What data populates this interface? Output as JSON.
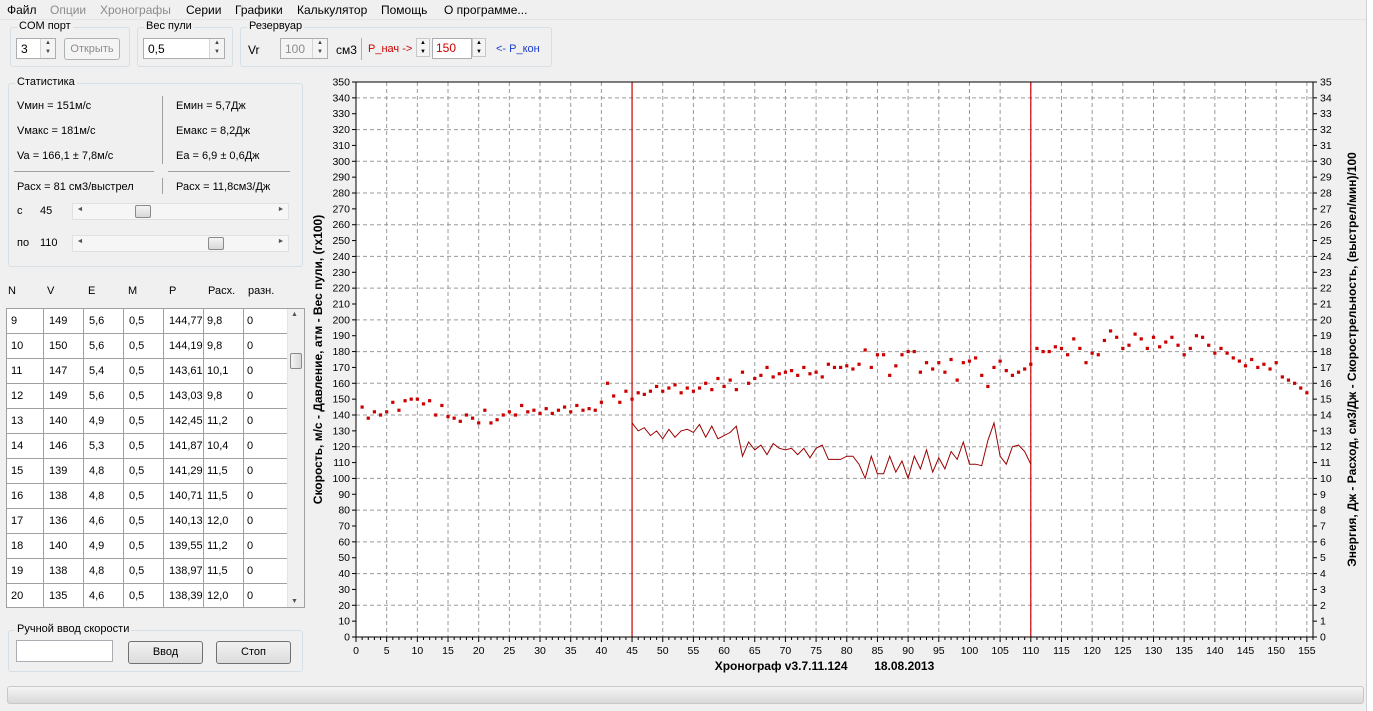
{
  "menu": [
    "Файл",
    "Опции",
    "Хронографы",
    "Серии",
    "Графики",
    "Калькулятор",
    "Помощь",
    "О программе..."
  ],
  "menu_disabled": [
    false,
    true,
    true,
    false,
    false,
    false,
    false,
    false
  ],
  "com": {
    "title": "COM порт",
    "value": "3",
    "open_label": "Открыть"
  },
  "bullet": {
    "title": "Вес пули",
    "value": "0,5"
  },
  "reservoir": {
    "title": "Резервуар",
    "vr_label": "Vr",
    "vr_value": "100",
    "unit": "см3",
    "p_start_label": "P_нач ->",
    "p_value": "150",
    "p_end_label": "<- P_кон"
  },
  "stats": {
    "title": "Статистика",
    "vmin": "Vмин = 151м/с",
    "vmax": "Vмакс = 181м/с",
    "va": "Va = 166,1 ± 7,8м/с",
    "emin": "Eмин = 5,7Дж",
    "emax": "Eмакс = 8,2Дж",
    "ea": "Ea = 6,9 ± 0,6Дж",
    "rate_shot": "Расх = 81 см3/выстрел",
    "rate_j": "Расх = 11,8см3/Дж",
    "from_label": "с",
    "from_value": "45",
    "from_fraction": 0.29,
    "to_label": "по",
    "to_value": "110",
    "to_fraction": 0.71
  },
  "table": {
    "headers": [
      "N",
      "V",
      "E",
      "M",
      "P",
      "Расх.",
      "разн."
    ],
    "rows": [
      [
        "9",
        "149",
        "5,6",
        "0,5",
        "144,77",
        "9,8",
        "0"
      ],
      [
        "10",
        "150",
        "5,6",
        "0,5",
        "144,19",
        "9,8",
        "0"
      ],
      [
        "11",
        "147",
        "5,4",
        "0,5",
        "143,61",
        "10,1",
        "0"
      ],
      [
        "12",
        "149",
        "5,6",
        "0,5",
        "143,03",
        "9,8",
        "0"
      ],
      [
        "13",
        "140",
        "4,9",
        "0,5",
        "142,45",
        "11,2",
        "0"
      ],
      [
        "14",
        "146",
        "5,3",
        "0,5",
        "141,87",
        "10,4",
        "0"
      ],
      [
        "15",
        "139",
        "4,8",
        "0,5",
        "141,29",
        "11,5",
        "0"
      ],
      [
        "16",
        "138",
        "4,8",
        "0,5",
        "140,71",
        "11,5",
        "0"
      ],
      [
        "17",
        "136",
        "4,6",
        "0,5",
        "140,13",
        "12,0",
        "0"
      ],
      [
        "18",
        "140",
        "4,9",
        "0,5",
        "139,55",
        "11,2",
        "0"
      ],
      [
        "19",
        "138",
        "4,8",
        "0,5",
        "138,97",
        "11,5",
        "0"
      ],
      [
        "20",
        "135",
        "4,6",
        "0,5",
        "138,39",
        "12,0",
        "0"
      ]
    ],
    "scroll_fraction": 0.12
  },
  "manual": {
    "title": "Ручной ввод скорости",
    "input_value": "",
    "enter_label": "Ввод",
    "stop_label": "Стоп"
  },
  "chart_data": {
    "type": "scatter",
    "xlabel": "Хронограф v3.7.11.124        18.08.2013",
    "ylabel_left": "Скорость, м/с - Давление, атм - Вес пули, (гх100)",
    "ylabel_right": "Энергия, Дж - Расход, см3/Дж - Скорострельность, (выстрел/мин)/100",
    "xlim": [
      0,
      156
    ],
    "ylim_left": [
      0,
      350
    ],
    "ylim_right": [
      0,
      35
    ],
    "x_ticks": [
      0,
      5,
      10,
      15,
      20,
      25,
      30,
      35,
      40,
      45,
      50,
      55,
      60,
      65,
      70,
      75,
      80,
      85,
      90,
      95,
      100,
      105,
      110,
      115,
      120,
      125,
      130,
      135,
      140,
      145,
      150,
      155
    ],
    "y_left_step": 10,
    "y_right_step": 1,
    "grid": true,
    "vertical_markers": [
      45,
      110
    ],
    "colors": {
      "points": "#cc0000",
      "line": "#990000",
      "markers": "#cc0000",
      "grid": "#9a9a9a"
    },
    "series": [
      {
        "type": "scatter",
        "axis": "left",
        "x": [
          1,
          2,
          3,
          4,
          5,
          6,
          7,
          8,
          9,
          10,
          11,
          12,
          13,
          14,
          15,
          16,
          17,
          18,
          19,
          20,
          21,
          22,
          23,
          24,
          25,
          26,
          27,
          28,
          29,
          30,
          31,
          32,
          33,
          34,
          35,
          36,
          37,
          38,
          39,
          40,
          41,
          42,
          43,
          44,
          45,
          46,
          47,
          48,
          49,
          50,
          51,
          52,
          53,
          54,
          55,
          56,
          57,
          58,
          59,
          60,
          61,
          62,
          63,
          64,
          65,
          66,
          67,
          68,
          69,
          70,
          71,
          72,
          73,
          74,
          75,
          76,
          77,
          78,
          79,
          80,
          81,
          82,
          83,
          84,
          85,
          86,
          87,
          88,
          89,
          90,
          91,
          92,
          93,
          94,
          95,
          96,
          97,
          98,
          99,
          100,
          101,
          102,
          103,
          104,
          105,
          106,
          107,
          108,
          109,
          110,
          111,
          112,
          113,
          114,
          115,
          116,
          117,
          118,
          119,
          120,
          121,
          122,
          123,
          124,
          125,
          126,
          127,
          128,
          129,
          130,
          131,
          132,
          133,
          134,
          135,
          136,
          137,
          138,
          139,
          140,
          141,
          142,
          143,
          144,
          145,
          146,
          147,
          148,
          149,
          150,
          151,
          152,
          153,
          154,
          155,
          156
        ],
        "y": [
          145,
          138,
          142,
          140,
          142,
          148,
          143,
          149,
          150,
          150,
          147,
          149,
          140,
          146,
          139,
          138,
          136,
          140,
          138,
          135,
          143,
          135,
          137,
          140,
          142,
          140,
          146,
          142,
          143,
          141,
          144,
          141,
          143,
          145,
          142,
          146,
          143,
          144,
          143,
          148,
          160,
          152,
          148,
          155,
          150,
          154,
          153,
          155,
          158,
          155,
          157,
          159,
          154,
          157,
          155,
          157,
          160,
          156,
          163,
          158,
          162,
          156,
          167,
          160,
          163,
          165,
          170,
          164,
          166,
          167,
          168,
          165,
          170,
          166,
          167,
          164,
          172,
          170,
          170,
          171,
          169,
          172,
          181,
          170,
          178,
          178,
          165,
          171,
          178,
          180,
          180,
          167,
          173,
          169,
          173,
          167,
          175,
          162,
          173,
          174,
          176,
          165,
          158,
          170,
          174,
          168,
          165,
          167,
          169,
          172,
          182,
          180,
          180,
          183,
          182,
          178,
          188,
          182,
          173,
          179,
          178,
          187,
          193,
          189,
          182,
          184,
          191,
          188,
          182,
          189,
          183,
          186,
          189,
          184,
          178,
          182,
          190,
          189,
          184,
          179,
          182,
          179,
          176,
          174,
          171,
          175,
          170,
          172,
          169,
          173,
          164,
          162,
          160,
          157,
          154,
          0
        ],
        "name": ""
      },
      {
        "type": "line",
        "axis": "right",
        "x": [
          45,
          46,
          47,
          48,
          49,
          50,
          51,
          52,
          53,
          54,
          55,
          56,
          57,
          58,
          59,
          60,
          61,
          62,
          63,
          64,
          65,
          66,
          67,
          68,
          69,
          70,
          71,
          72,
          73,
          74,
          75,
          76,
          77,
          78,
          79,
          80,
          81,
          82,
          83,
          84,
          85,
          86,
          87,
          88,
          89,
          90,
          91,
          92,
          93,
          94,
          95,
          96,
          97,
          98,
          99,
          100,
          101,
          102,
          103,
          104,
          105,
          106,
          107,
          108,
          109,
          110
        ],
        "y": [
          13.5,
          13.0,
          13.2,
          12.7,
          13.0,
          12.5,
          13.1,
          12.6,
          13.0,
          13.1,
          12.9,
          13.4,
          12.6,
          13.3,
          12.5,
          12.7,
          12.9,
          13.3,
          11.4,
          12.3,
          11.8,
          12.1,
          11.5,
          12.2,
          11.9,
          11.8,
          11.9,
          11.5,
          11.9,
          11.3,
          11.9,
          12.1,
          11.2,
          11.2,
          11.2,
          11.4,
          11.4,
          10.9,
          10.0,
          11.4,
          10.3,
          10.3,
          11.4,
          10.4,
          11.1,
          10.0,
          11.4,
          10.6,
          11.8,
          10.4,
          11.3,
          10.6,
          11.7,
          11.2,
          12.3,
          10.9,
          10.9,
          10.8,
          12.4,
          13.5,
          11.4,
          10.9,
          12.0,
          12.1,
          11.7,
          10.9
        ]
      }
    ]
  }
}
